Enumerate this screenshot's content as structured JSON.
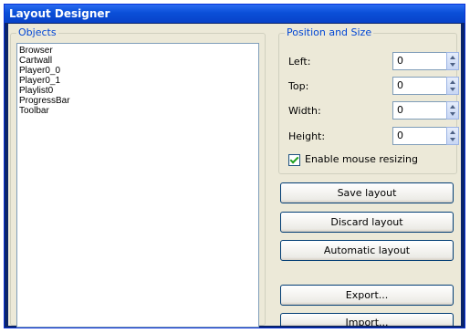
{
  "window": {
    "title": "Layout Designer"
  },
  "objects": {
    "group_title": "Objects",
    "items": [
      "Browser",
      "Cartwall",
      "Player0_0",
      "Player0_1",
      "Playlist0",
      "ProgressBar",
      "Toolbar"
    ]
  },
  "position": {
    "group_title": "Position and Size",
    "fields": [
      {
        "label": "Left:",
        "value": "0"
      },
      {
        "label": "Top:",
        "value": "0"
      },
      {
        "label": "Width:",
        "value": "0"
      },
      {
        "label": "Height:",
        "value": "0"
      }
    ],
    "mouse_resize_label": "Enable mouse resizing",
    "mouse_resize_checked": true
  },
  "buttons": {
    "save": "Save layout",
    "discard": "Discard layout",
    "automatic": "Automatic layout",
    "export": "Export...",
    "import": "Import..."
  },
  "colors": {
    "title_bar": "#0a4fd8",
    "group_title": "#0046d5",
    "dialog_bg": "#ece9d8"
  }
}
